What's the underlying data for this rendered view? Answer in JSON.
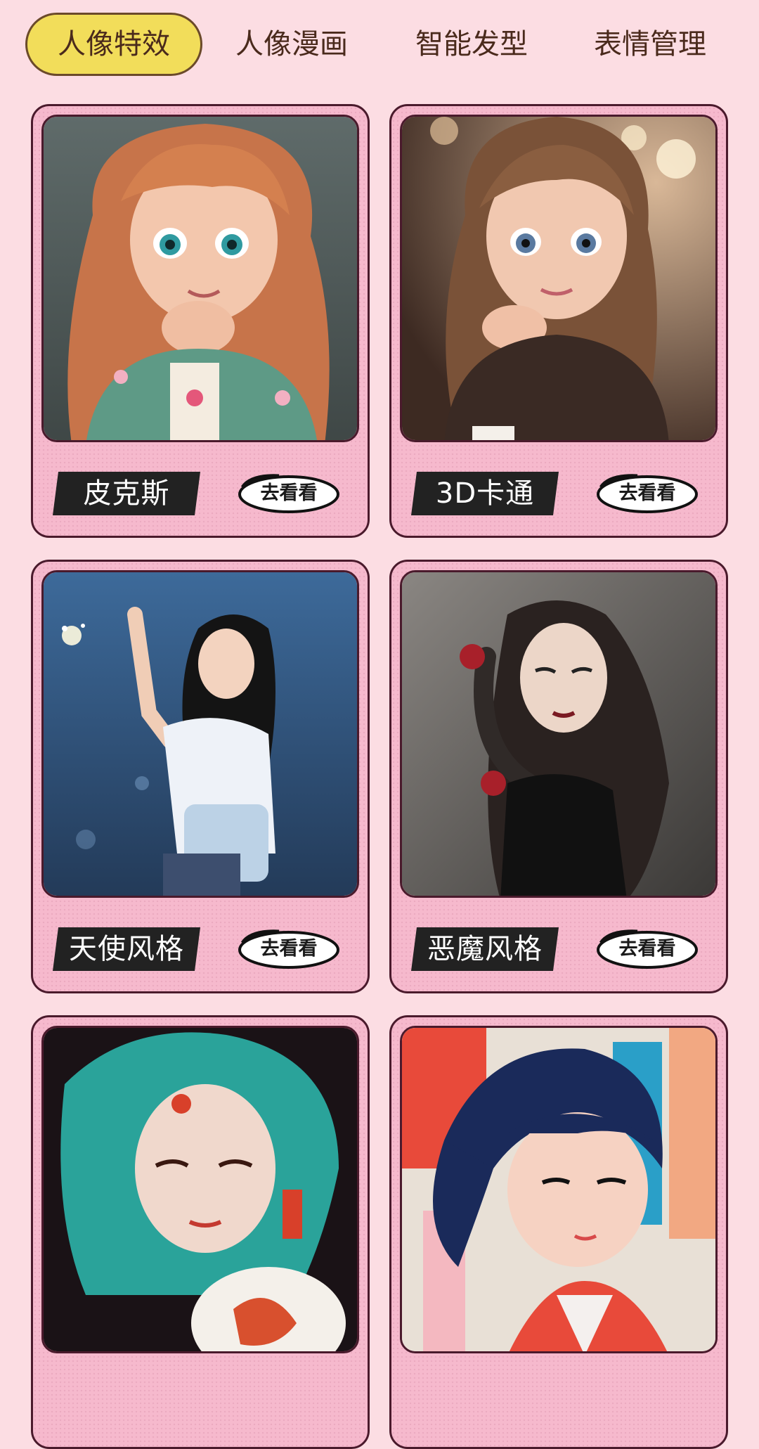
{
  "tabs": [
    {
      "label": "人像特效",
      "active": true
    },
    {
      "label": "人像漫画",
      "active": false
    },
    {
      "label": "智能发型",
      "active": false
    },
    {
      "label": "表情管理",
      "active": false
    }
  ],
  "cards": [
    {
      "title": "皮克斯",
      "action": "去看看"
    },
    {
      "title": "3D卡通",
      "action": "去看看"
    },
    {
      "title": "天使风格",
      "action": "去看看"
    },
    {
      "title": "恶魔风格",
      "action": "去看看"
    },
    {
      "title": "",
      "action": ""
    },
    {
      "title": "",
      "action": ""
    }
  ],
  "colors": {
    "page_bg": "#fcdde3",
    "card_bg": "#f6b9cd",
    "card_border": "#4a1a2c",
    "active_tab": "#f2dd5a",
    "tab_text": "#4a2a1c",
    "name_tag": "#222222"
  }
}
